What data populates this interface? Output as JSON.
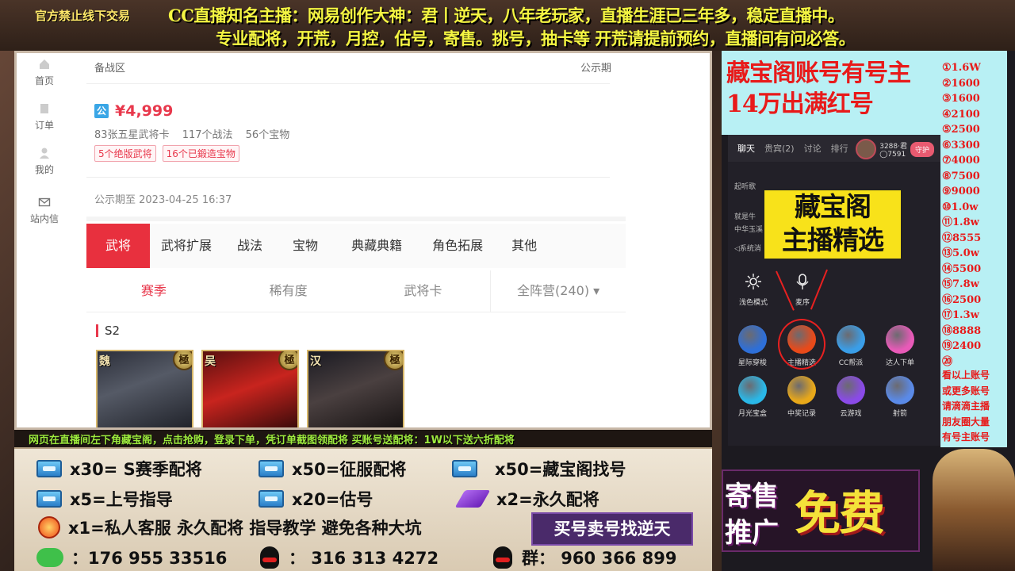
{
  "top_banner": {
    "warning": "官方禁止线下交易",
    "line1": "CC直播知名主播：网易创作大神：君丨逆天，八年老玩家，直播生涯已三年多，稳定直播中。",
    "line2": "专业配将，开荒，月控，估号，寄售。挑号，抽卡等   开荒请提前预约，直播间有问必答。"
  },
  "sidebar": {
    "items": [
      {
        "label": "首页",
        "icon": "home-icon"
      },
      {
        "label": "订单",
        "icon": "order-icon"
      },
      {
        "label": "我的",
        "icon": "user-icon"
      },
      {
        "label": "站内信",
        "icon": "mail-icon"
      }
    ]
  },
  "listing": {
    "status_left": "备战区",
    "status_right": "公示期",
    "badge": "公",
    "price": "¥4,999",
    "stats": [
      "83张五星武将卡",
      "117个战法",
      "56个宝物"
    ],
    "tags": [
      "5个绝版武将",
      "16个已鍛造宝物"
    ],
    "pub_date": "公示期至 2023-04-25 16:37"
  },
  "main_tabs": [
    "武将",
    "武将扩展",
    "战法",
    "宝物",
    "典藏典籍",
    "角色拓展",
    "其他"
  ],
  "sub_tabs": [
    "赛季",
    "稀有度",
    "武将卡",
    "全阵营(240) ▾"
  ],
  "season": {
    "title": "S2",
    "cards": [
      {
        "faction": "魏",
        "rank": "極"
      },
      {
        "faction": "吴",
        "rank": "極"
      },
      {
        "faction": "汉",
        "rank": "極"
      }
    ]
  },
  "ticker": "网页在直播间左下角藏宝阁，点击抢购，登录下单，凭订单截图领配将   买账号送配将：1W以下送六折配将",
  "info": {
    "r1": [
      "x30= S赛季配将",
      "x50=征服配将",
      "x50=藏宝阁找号"
    ],
    "r2": [
      "x5=上号指导",
      "x20=估号",
      "x2=永久配将"
    ],
    "r3": "x1=私人客服 永久配将  指导教学 避免各种大坑",
    "promo": "买号卖号找逆天",
    "contact_wechat": "：176 955 33516",
    "contact_qq": "：  316 313 4272",
    "contact_group": "群：  960 366 899"
  },
  "right": {
    "title1": "藏宝阁账号有号主",
    "title2": "14万出满红号",
    "price_list": [
      "①1.6W",
      "②1600",
      "③1600",
      "④2100",
      "⑤2500",
      "⑥3300",
      "⑦4000",
      "⑧7500",
      "⑨9000",
      "⑩1.0w",
      "⑪1.8w",
      "⑫8555",
      "⑬5.0w",
      "⑭5500",
      "⑮7.8w",
      "⑯2500",
      "⑰1.3w",
      "⑱8888",
      "⑲2400",
      "⑳"
    ],
    "notes": [
      "看以上账号",
      "或更多账号",
      "请滴滴主播",
      "朋友圈大量",
      "有号主账号"
    ]
  },
  "phone": {
    "tabs": [
      "聊天",
      "贵宾(2)",
      "讨论",
      "排行"
    ],
    "user_name": "3288·君",
    "user_sub": "◯7591",
    "guard_label": "守护",
    "chat_lines": [
      "起听歌",
      "就是牛",
      "中华玉溪",
      "◁系统消"
    ],
    "overlay_line1": "藏宝阁",
    "overlay_line2": "主播精选",
    "tools_top": [
      {
        "label": "浅色模式",
        "icon": "brightness-icon"
      },
      {
        "label": "麦序",
        "icon": "microphone-icon"
      }
    ],
    "tools_mid": [
      {
        "label": "星际穿梭",
        "color": "#2e6fd8"
      },
      {
        "label": "主播精选",
        "color": "#e84a1a"
      },
      {
        "label": "CC帮派",
        "color": "#3a9ee8"
      },
      {
        "label": "达人下单",
        "color": "#e85ab8"
      }
    ],
    "tools_bot": [
      {
        "label": "月光宝盒",
        "color": "#2ab8e8"
      },
      {
        "label": "中奖记录",
        "color": "#e8a81a"
      },
      {
        "label": "云游戏",
        "color": "#8a4ae8"
      },
      {
        "label": "射箭",
        "color": "#5a8ae8"
      }
    ]
  },
  "sell": {
    "line1": "寄售",
    "line2": "推广",
    "big": "免费"
  }
}
